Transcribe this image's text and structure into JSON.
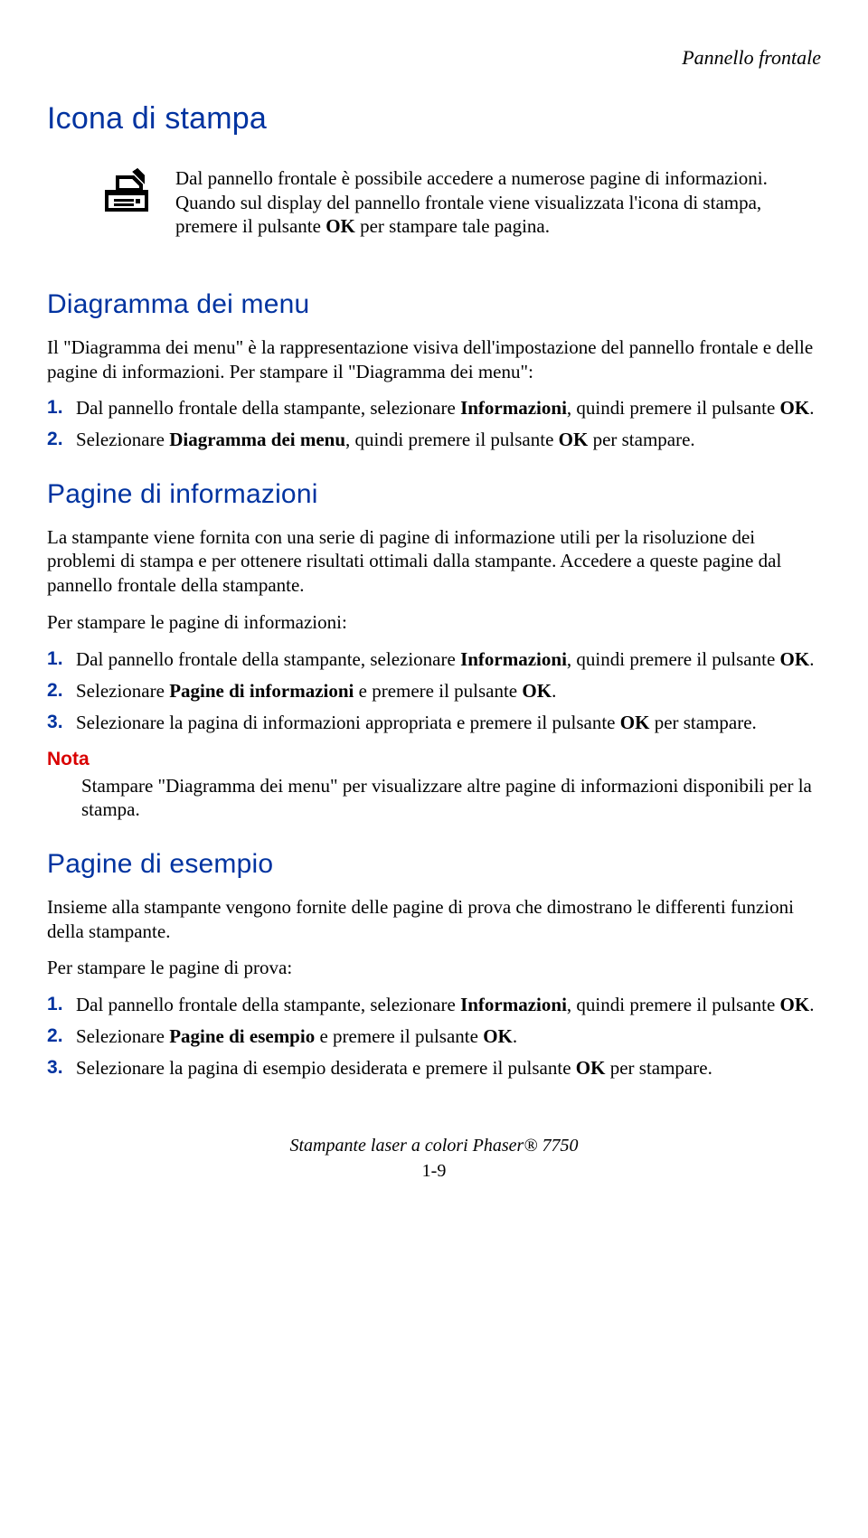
{
  "breadcrumb": "Pannello frontale",
  "h1": "Icona di stampa",
  "intro": "Dal pannello frontale è possibile accedere a numerose pagine di informazioni. Quando sul display del pannello frontale viene visualizzata l'icona di stampa, premere il pulsante <b>OK</b> per stampare tale pagina.",
  "s1": {
    "title": "Diagramma dei menu",
    "p": "Il \"Diagramma dei menu\" è la rappresentazione visiva dell'impostazione del pannello frontale e delle pagine di informazioni. Per stampare il \"Diagramma dei menu\":",
    "li1": "Dal pannello frontale della stampante, selezionare <b>Informazioni</b>, quindi premere il pulsante <b>OK</b>.",
    "li2": "Selezionare <b>Diagramma dei menu</b>, quindi premere il pulsante <b>OK</b> per stampare."
  },
  "s2": {
    "title": "Pagine di informazioni",
    "p1": "La stampante viene fornita con una serie di pagine di informazione utili per la risoluzione dei problemi di stampa e per ottenere risultati ottimali dalla stampante. Accedere a queste pagine dal pannello frontale della stampante.",
    "p2": "Per stampare le pagine di informazioni:",
    "li1": "Dal pannello frontale della stampante, selezionare <b>Informazioni</b>, quindi premere il pulsante <b>OK</b>.",
    "li2": "Selezionare <b>Pagine di informazioni</b> e premere il pulsante <b>OK</b>.",
    "li3": "Selezionare la pagina di informazioni appropriata e premere il pulsante <b>OK</b> per stampare.",
    "note_label": "Nota",
    "note": "Stampare \"Diagramma dei menu\" per visualizzare altre pagine di informazioni disponibili per la stampa."
  },
  "s3": {
    "title": "Pagine di esempio",
    "p1": "Insieme alla stampante vengono fornite delle pagine di prova che dimostrano le differenti funzioni della stampante.",
    "p2": "Per stampare le pagine di prova:",
    "li1": "Dal pannello frontale della stampante, selezionare <b>Informazioni</b>, quindi premere il pulsante <b>OK</b>.",
    "li2": "Selezionare <b>Pagine di esempio</b> e premere il pulsante <b>OK</b>.",
    "li3": "Selezionare la pagina di esempio desiderata e premere il pulsante <b>OK</b> per stampare."
  },
  "footer_line": "Stampante laser a colori Phaser® 7750",
  "footer_page": "1-9",
  "icon_name": "print-icon"
}
